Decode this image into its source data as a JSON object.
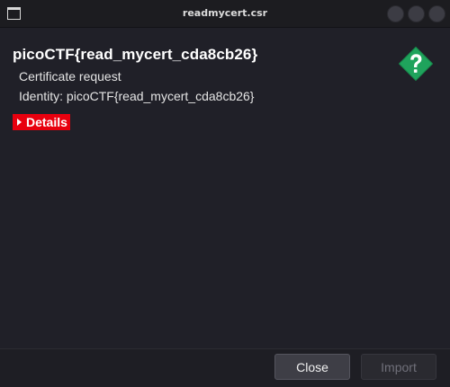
{
  "window": {
    "title": "readmycert.csr"
  },
  "certificate": {
    "name": "picoCTF{read_mycert_cda8cb26}",
    "type": "Certificate request",
    "identity": "Identity: picoCTF{read_mycert_cda8cb26}"
  },
  "details": {
    "label": "Details",
    "expanded": false
  },
  "icons": {
    "app": "window-icon",
    "help": "question-icon",
    "expander": "triangle-right-icon",
    "help_color": "#1fa35c"
  },
  "buttons": {
    "close_label": "Close",
    "import_label": "Import",
    "import_enabled": false
  },
  "colors": {
    "accent": "#e8000e",
    "background": "#202028"
  }
}
